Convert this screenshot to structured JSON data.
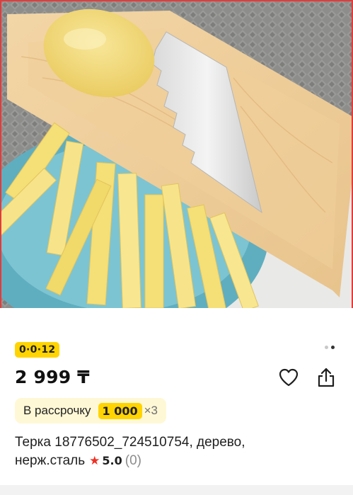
{
  "product_image": {
    "alt_icon": "potato-slicer-photo"
  },
  "badge": {
    "text": "0·0·12",
    "color": "#ffd400"
  },
  "gallery": {
    "dot_count": 2,
    "active_index": 1
  },
  "price": {
    "text": "2 999 ₸"
  },
  "actions": {
    "favorite_icon": "heart-icon",
    "share_icon": "share-icon"
  },
  "installment": {
    "label": "В рассрочку",
    "amount": "1 000",
    "multiplier": "×3"
  },
  "product": {
    "title": "Терка 18776502_724510754, дерево, нерж.сталь",
    "rating": "5.0",
    "reviews": "(0)",
    "star_color": "#ef3124"
  }
}
